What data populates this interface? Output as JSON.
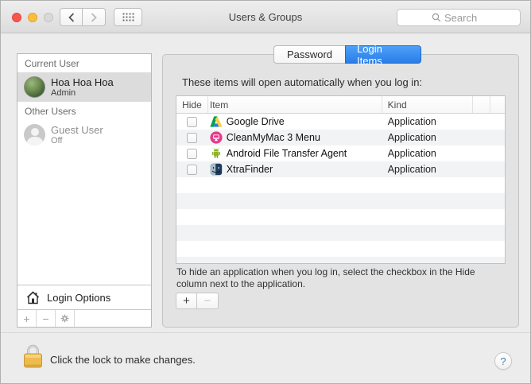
{
  "titlebar": {
    "title": "Users & Groups",
    "search_placeholder": "Search"
  },
  "tabs": [
    {
      "label": "Password",
      "selected": false
    },
    {
      "label": "Login Items",
      "selected": true
    }
  ],
  "sidebar": {
    "current_user_header": "Current User",
    "current_user_name": "Hoa Hoa Hoa",
    "current_user_role": "Admin",
    "other_users_header": "Other Users",
    "guest_name": "Guest User",
    "guest_status": "Off",
    "login_options_label": "Login Options",
    "add_label": "+",
    "remove_label": "−"
  },
  "main": {
    "heading": "These items will open automatically when you log in:",
    "table": {
      "columns": [
        "Hide",
        "Item",
        "Kind"
      ],
      "rows": [
        {
          "hide": false,
          "item": "Google Drive",
          "kind": "Application",
          "icon": "icon-google-drive"
        },
        {
          "hide": false,
          "item": "CleanMyMac 3 Menu",
          "kind": "Application",
          "icon": "icon-cleanmymac"
        },
        {
          "hide": false,
          "item": "Android File Transfer Agent",
          "kind": "Application",
          "icon": "icon-android"
        },
        {
          "hide": false,
          "item": "XtraFinder",
          "kind": "Application",
          "icon": "icon-xtrafinder"
        }
      ]
    },
    "help_text": "To hide an application when you log in, select the checkbox in the Hide column next to the application.",
    "add_label": "+",
    "remove_label": "−"
  },
  "footer": {
    "lock_text": "Click the lock to make changes.",
    "help_label": "?"
  },
  "colors": {
    "accent_blue": "#2a7de8",
    "selected_row_gray": "#dcdcdc",
    "lock_gold": "#eebc4e",
    "panel_gray": "#e3e3e3"
  }
}
